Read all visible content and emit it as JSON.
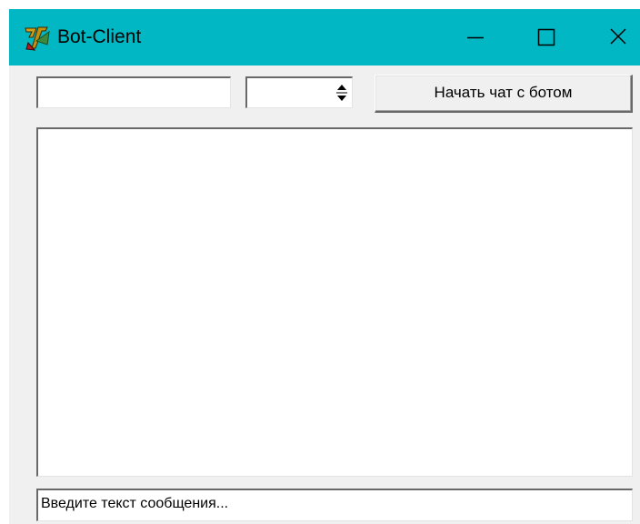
{
  "window": {
    "title": "Bot-Client",
    "title_bar_color": "#00b7c3",
    "icon": "delphi-app-icon",
    "controls": [
      "minimize-icon",
      "maximize-icon",
      "close-icon"
    ]
  },
  "toolbar": {
    "name_input_value": "",
    "spin_value": "",
    "start_button_label": "Начать чат с ботом"
  },
  "chat": {
    "log_text": ""
  },
  "message": {
    "input_value": "Введите текст сообщения..."
  }
}
